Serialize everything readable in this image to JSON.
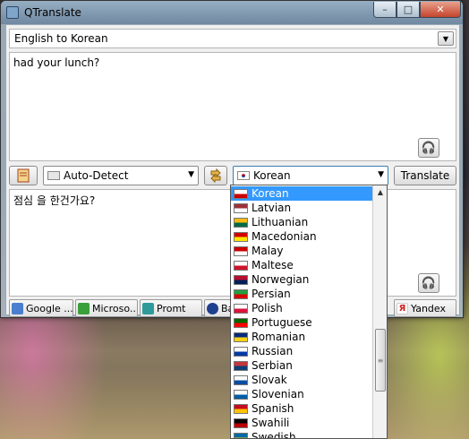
{
  "window": {
    "title": "QTranslate"
  },
  "direction": {
    "label": "English to Korean"
  },
  "source": {
    "text": "had your lunch?"
  },
  "controls": {
    "source_lang": "Auto-Detect",
    "target_lang": "Korean",
    "translate_label": "Translate"
  },
  "target": {
    "text": "점심 을 한건가요?"
  },
  "engines": [
    {
      "label": "Google ...",
      "color": "#4a7fd0"
    },
    {
      "label": "Microso...",
      "color": "#3aa03a"
    },
    {
      "label": "Promt",
      "color": "#2f9a9a"
    },
    {
      "label": "Ba",
      "color": "#1f3f8f"
    },
    {
      "label": "Yandex",
      "color": "#d02020"
    }
  ],
  "dropdown": {
    "selected": "Korean",
    "items": [
      {
        "name": "Korean",
        "colors": [
          "#ffffff",
          "#c00"
        ]
      },
      {
        "name": "Latvian",
        "colors": [
          "#9e3039",
          "#ffffff"
        ]
      },
      {
        "name": "Lithuanian",
        "colors": [
          "#fdb913",
          "#006a44"
        ]
      },
      {
        "name": "Macedonian",
        "colors": [
          "#d20000",
          "#ffe600"
        ]
      },
      {
        "name": "Malay",
        "colors": [
          "#cc0001",
          "#ffffff"
        ]
      },
      {
        "name": "Maltese",
        "colors": [
          "#ffffff",
          "#cf142b"
        ]
      },
      {
        "name": "Norwegian",
        "colors": [
          "#ba0c2f",
          "#00205b"
        ]
      },
      {
        "name": "Persian",
        "colors": [
          "#239f40",
          "#da0000"
        ]
      },
      {
        "name": "Polish",
        "colors": [
          "#ffffff",
          "#dc143c"
        ]
      },
      {
        "name": "Portuguese",
        "colors": [
          "#006600",
          "#ff0000"
        ]
      },
      {
        "name": "Romanian",
        "colors": [
          "#002b7f",
          "#fcd116"
        ]
      },
      {
        "name": "Russian",
        "colors": [
          "#ffffff",
          "#0039a6"
        ]
      },
      {
        "name": "Serbian",
        "colors": [
          "#c6363c",
          "#0c4076"
        ]
      },
      {
        "name": "Slovak",
        "colors": [
          "#ffffff",
          "#0b4ea2"
        ]
      },
      {
        "name": "Slovenian",
        "colors": [
          "#ffffff",
          "#005da4"
        ]
      },
      {
        "name": "Spanish",
        "colors": [
          "#c60b1e",
          "#ffc400"
        ]
      },
      {
        "name": "Swahili",
        "colors": [
          "#000000",
          "#bb0000"
        ]
      },
      {
        "name": "Swedish",
        "colors": [
          "#006aa7",
          "#fecc00"
        ]
      }
    ]
  }
}
